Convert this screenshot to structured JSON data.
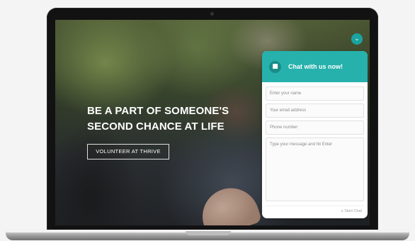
{
  "hero": {
    "headline_line1": "BE A PART OF SOMEONE'S",
    "headline_line2": "SECOND CHANCE AT LIFE",
    "cta_label": "VOLUNTEER AT THRIVE"
  },
  "chat": {
    "toggle_icon": "chevron-down-icon",
    "header_icon": "chat-bubbles-icon",
    "title": "Chat with us now!",
    "fields": {
      "name_placeholder": "Enter your name",
      "email_placeholder": "Your email address",
      "phone_placeholder": "Phone number",
      "message_placeholder": "Type your message and hit Enter"
    },
    "footer_text": "≡ Start Chat"
  },
  "colors": {
    "accent": "#26b1ac",
    "accent_dark": "#1a8d89",
    "bezel": "#121212"
  }
}
